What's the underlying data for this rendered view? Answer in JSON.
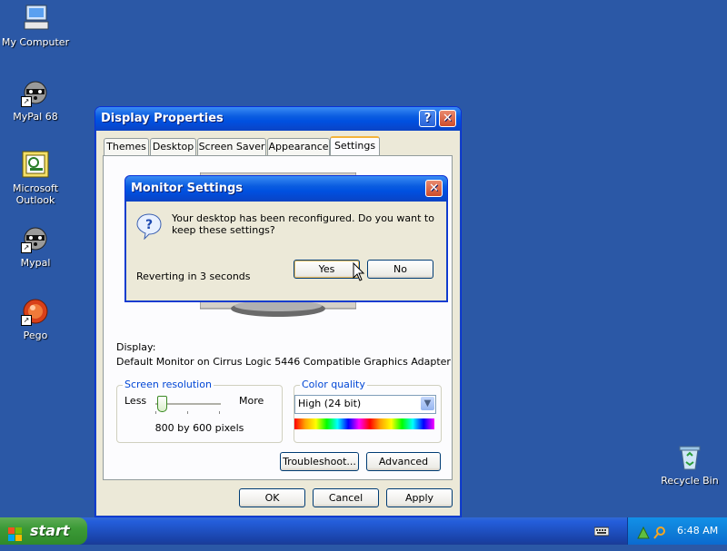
{
  "desktop": {
    "icons": [
      {
        "label": "My Computer"
      },
      {
        "label": "MyPal 68"
      },
      {
        "label": "Microsoft Outlook"
      },
      {
        "label": "Mypal"
      },
      {
        "label": "Pego"
      },
      {
        "label": "Recycle Bin"
      }
    ]
  },
  "display_properties": {
    "title": "Display Properties",
    "tabs": [
      "Themes",
      "Desktop",
      "Screen Saver",
      "Appearance",
      "Settings"
    ],
    "display_label": "Display:",
    "display_value": "Default Monitor on Cirrus Logic 5446 Compatible Graphics Adapter",
    "screen_resolution": {
      "label": "Screen resolution",
      "less": "Less",
      "more": "More",
      "value": "800 by 600 pixels",
      "level": 0
    },
    "color_quality": {
      "label": "Color quality",
      "value": "High (24 bit)"
    },
    "buttons": {
      "troubleshoot": "Troubleshoot...",
      "advanced": "Advanced",
      "ok": "OK",
      "cancel": "Cancel",
      "apply": "Apply"
    }
  },
  "monitor_settings": {
    "title": "Monitor Settings",
    "message": "Your desktop has been reconfigured.  Do you want to keep these settings?",
    "countdown": "Reverting in 3 seconds",
    "yes": "Yes",
    "no": "No"
  },
  "taskbar": {
    "start": "start",
    "clock": "6:48 AM"
  },
  "colors": {
    "desktop": "#2b58a6",
    "titlebar": "#0a5ce0",
    "accent_link": "#0046d5"
  }
}
